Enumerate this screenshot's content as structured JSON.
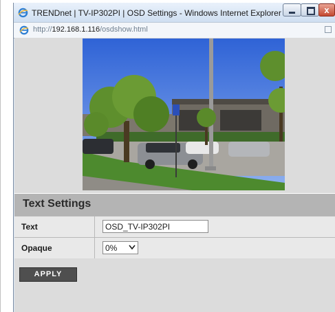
{
  "window": {
    "title": "TRENDnet | TV-IP302PI | OSD Settings - Windows Internet Explorer",
    "close_glyph": "x",
    "icon": "ie-icon"
  },
  "address_bar": {
    "scheme": "http://",
    "host": "192.168.1.116",
    "path": "/osdshow.html"
  },
  "settings": {
    "title": "Text Settings",
    "rows": [
      {
        "label": "Text",
        "value": "OSD_TV-IP302PI"
      },
      {
        "label": "Opaque",
        "value": "0%"
      }
    ],
    "apply_label": "APPLY"
  },
  "colors": {
    "header_bg": "#b4b4b4",
    "row_bg": "#e9e9e9",
    "button_bg": "#4f4f4f",
    "page_bg": "#dcdcdc"
  }
}
